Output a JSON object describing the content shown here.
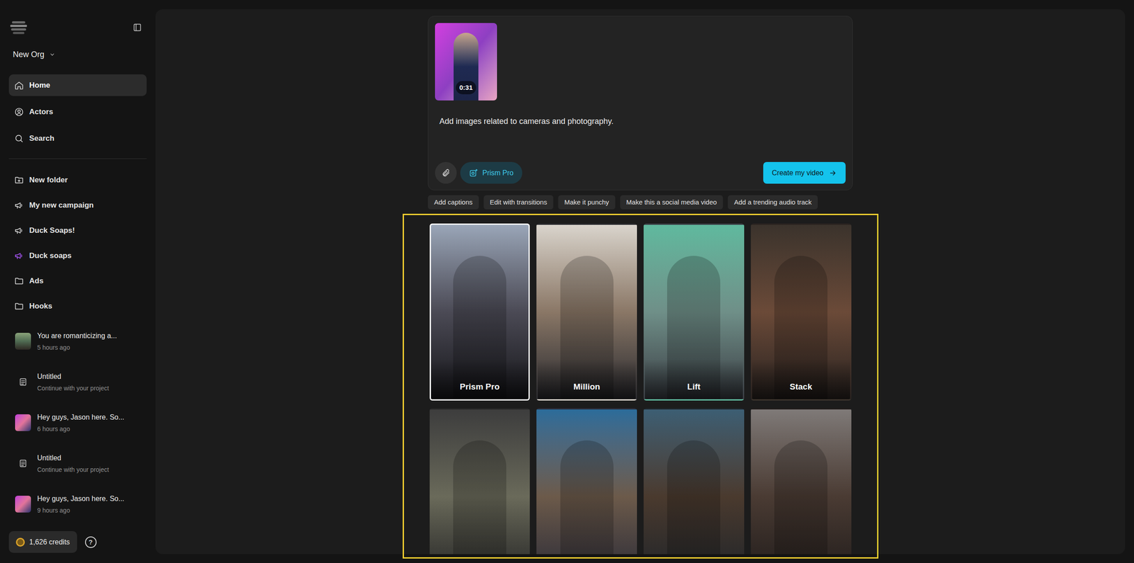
{
  "sidebar": {
    "org": "New Org",
    "nav": [
      {
        "label": "Home",
        "selected": true
      },
      {
        "label": "Actors",
        "selected": false
      },
      {
        "label": "Search",
        "selected": false
      }
    ],
    "folders": [
      {
        "label": "New folder",
        "kind": "new-folder",
        "color": "#d4d4d4"
      },
      {
        "label": "My new campaign",
        "kind": "campaign",
        "color": "#d4d4d4"
      },
      {
        "label": "Duck Soaps!",
        "kind": "campaign",
        "color": "#d4d4d4"
      },
      {
        "label": "Duck soaps",
        "kind": "campaign",
        "color": "#a855f7"
      },
      {
        "label": "Ads",
        "kind": "folder",
        "color": "#d4d4d4"
      },
      {
        "label": "Hooks",
        "kind": "folder",
        "color": "#d4d4d4"
      }
    ],
    "recents": [
      {
        "title": "You are romanticizing a...",
        "subtitle": "5 hours ago",
        "kind": "photo"
      },
      {
        "title": "Untitled",
        "subtitle": "Continue with your project",
        "kind": "blank"
      },
      {
        "title": "Hey guys, Jason here. So...",
        "subtitle": "6 hours ago",
        "kind": "avatar"
      },
      {
        "title": "Untitled",
        "subtitle": "Continue with your project",
        "kind": "blank"
      },
      {
        "title": "Hey guys, Jason here. So...",
        "subtitle": "9 hours ago",
        "kind": "avatar"
      }
    ],
    "credits": "1,626 credits",
    "help": "?"
  },
  "composer": {
    "duration": "0:31",
    "prompt": "Add images related to cameras and photography.",
    "style": "Prism Pro",
    "submit": "Create my video"
  },
  "suggestions": [
    "Add captions",
    "Edit with transitions",
    "Make it punchy",
    "Make this a social media video",
    "Add a trending audio track"
  ],
  "templates": [
    {
      "name": "Prism Pro",
      "selected": true
    },
    {
      "name": "Million",
      "selected": false
    },
    {
      "name": "Lift",
      "selected": false
    },
    {
      "name": "Stack",
      "selected": false
    },
    {
      "selected": false
    },
    {
      "selected": false
    },
    {
      "selected": false
    },
    {
      "selected": false
    }
  ]
}
